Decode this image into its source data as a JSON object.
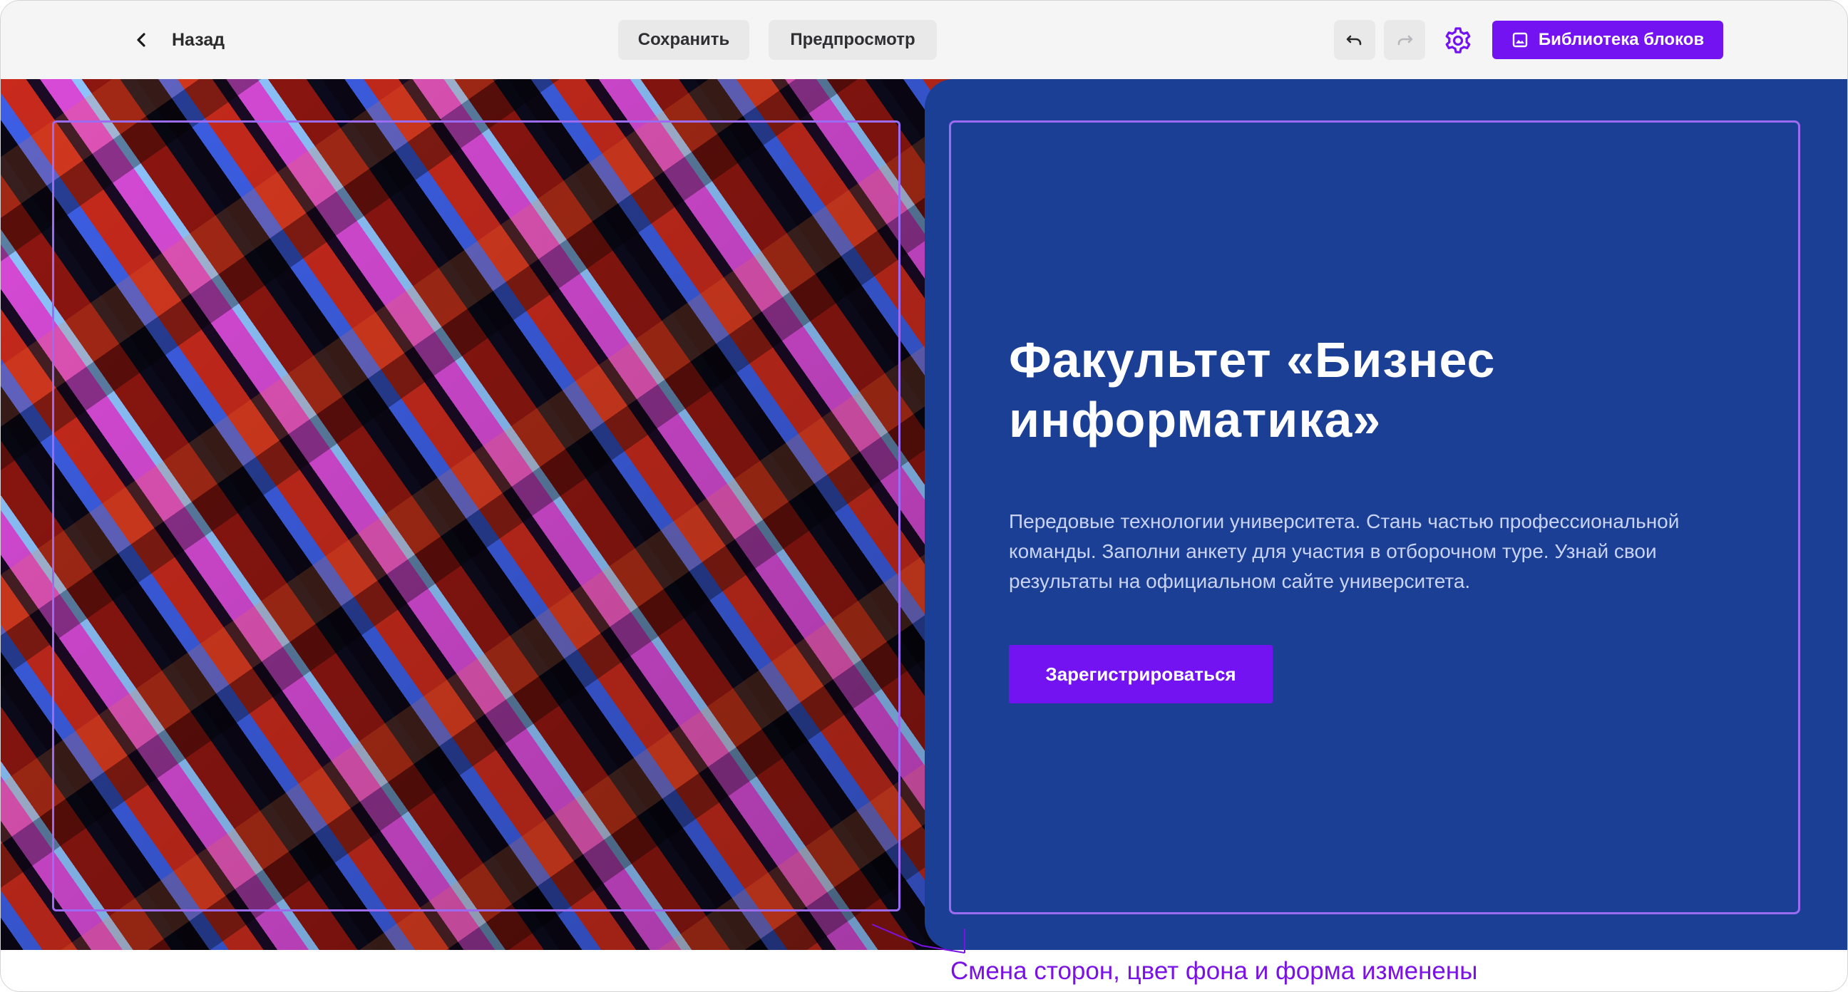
{
  "toolbar": {
    "back_label": "Назад",
    "save_label": "Сохранить",
    "preview_label": "Предпросмотр",
    "library_label": "Библиотека блоков"
  },
  "hero": {
    "headline": "Факультет «Бизнес информатика»",
    "description": "Передовые технологии университета. Стань частью профессиональной команды. Заполни анкету для участия в отборочном туре. Узнай свои результаты на официальном сайте университета.",
    "cta_label": "Зарегистрироваться"
  },
  "annotation": {
    "text": "Смена сторон, цвет фона и форма изменены"
  },
  "icons": {
    "back": "chevron-left-icon",
    "undo": "undo-icon",
    "redo": "redo-icon",
    "settings": "gear-icon",
    "library": "image-icon"
  },
  "colors": {
    "accent": "#7313f1",
    "panel_background": "#1c3f96",
    "selection_outline": "#9b6bf2",
    "annotation_text": "#7a12e6",
    "toolbar_background": "#f5f5f5"
  }
}
